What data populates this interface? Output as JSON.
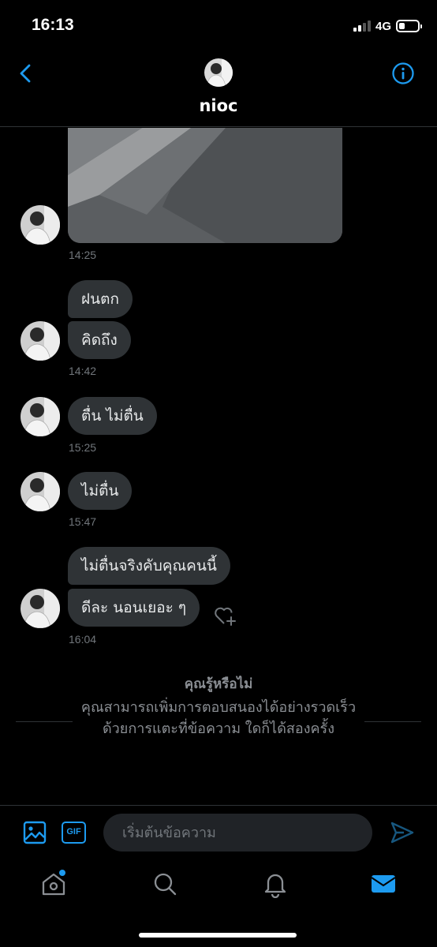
{
  "status_bar": {
    "time": "16:13",
    "network": "4G",
    "battery_level": 0.3
  },
  "header": {
    "contact_name": "nioc",
    "back_icon": "chevron-left-icon",
    "info_icon": "info-icon"
  },
  "messages": {
    "image_time": "14:25",
    "group2": {
      "bubbles": [
        "ฝนตก",
        "คิดถึง"
      ],
      "time": "14:42"
    },
    "group3": {
      "bubbles": [
        "ตื่น ไม่ตื่น"
      ],
      "time": "15:25"
    },
    "group4": {
      "bubbles": [
        "ไม่ตื่น"
      ],
      "time": "15:47"
    },
    "group5": {
      "bubbles": [
        "ไม่ตื่นจริงคับคุณคนนี้",
        "ดีละ นอนเยอะ ๆ"
      ],
      "time": "16:04"
    }
  },
  "tip": {
    "title": "คุณรู้หรือไม่",
    "body": "คุณสามารถเพิ่มการตอบสนองได้อย่างรวดเร็วด้วยการแตะที่ข้อความ ใดก็ได้สองครั้ง"
  },
  "composer": {
    "gif_label": "GIF",
    "placeholder": "เริ่มต้นข้อความ"
  },
  "colors": {
    "accent": "#1d9bf0",
    "bubble": "#2f3336",
    "background": "#000000",
    "muted": "#71767b"
  }
}
